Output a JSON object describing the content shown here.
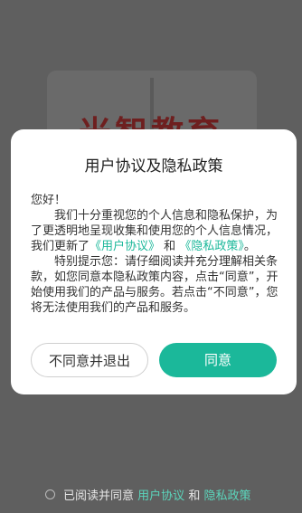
{
  "background": {
    "title": "米智教育"
  },
  "dialog": {
    "title": "用户协议及隐私政策",
    "greeting": "您好！",
    "p1_text": "我们十分重视您的个人信息和隐私保护，为了更透明地呈现收集和使用您的个人信息情况，我们更新了",
    "p1_link1": "《用户协议》",
    "p1_and": "和",
    "p1_link2": "《隐私政策》",
    "p1_end": "。",
    "p2_text": "特别提示您：请仔细阅读并充分理解相关条款，如您同意本隐私政策内容，点击“同意”，开始使用我们的产品与服务。若点击“不同意”，您将无法使用我们的产品和服务。",
    "decline_label": "不同意并退出",
    "agree_label": "同意"
  },
  "footer": {
    "prefix": "已阅读并同意",
    "link1": "用户协议",
    "and": "和",
    "link2": "隐私政策"
  },
  "colors": {
    "accent": "#1bb89a",
    "overlay": "#5f5f5f"
  }
}
